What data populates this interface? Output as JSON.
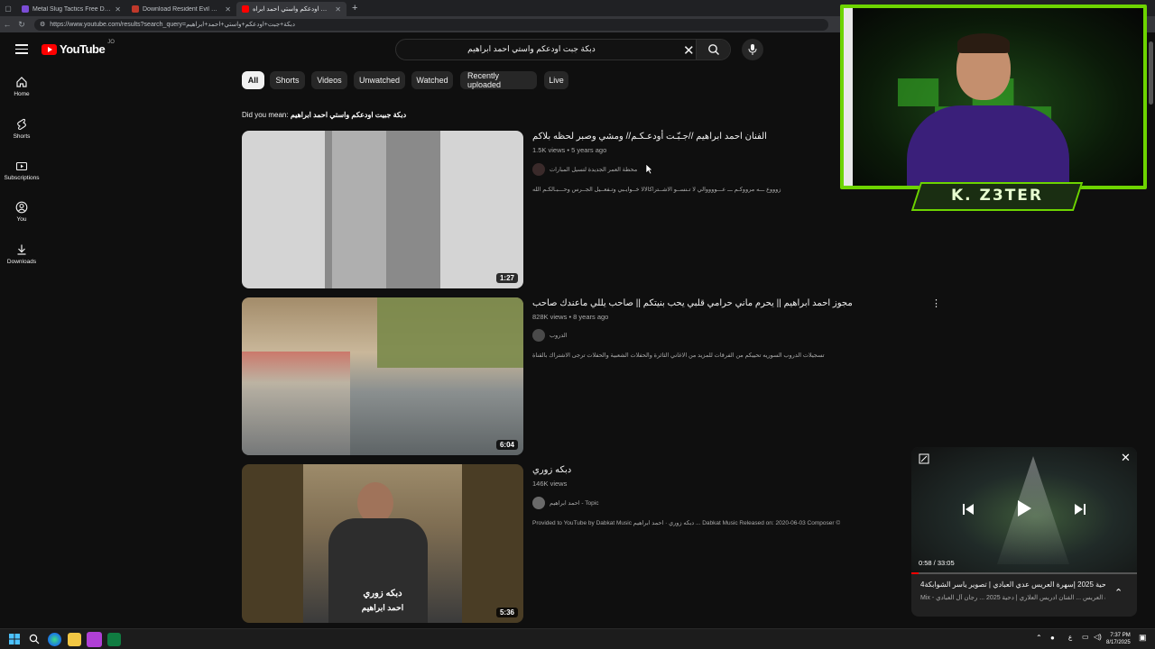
{
  "browser": {
    "tabs": [
      {
        "title": "Metal Slug Tactics Free Download",
        "color": "#7b4dd6"
      },
      {
        "title": "Download Resident Evil Village Tl",
        "color": "#c0392b"
      },
      {
        "title": "دبكة جبت اودعكم واستي احمد ابراه",
        "color": "#ff0000"
      }
    ],
    "url": "https://www.youtube.com/results?search_query=دبكة+جبت+اودعكم+واستي+احمد+ابراهيم"
  },
  "header": {
    "logo_text": "YouTube",
    "country": "JO",
    "search_value": "دبكة جبت اودعكم واستي احمد ابراهيم"
  },
  "sidebar": {
    "items": [
      {
        "label": "Home",
        "icon": "home-icon"
      },
      {
        "label": "Shorts",
        "icon": "shorts-icon"
      },
      {
        "label": "Subscriptions",
        "icon": "subscriptions-icon"
      },
      {
        "label": "You",
        "icon": "you-icon"
      },
      {
        "label": "Downloads",
        "icon": "downloads-icon"
      }
    ]
  },
  "chips": [
    "All",
    "Shorts",
    "Videos",
    "Unwatched",
    "Watched",
    "Recently uploaded",
    "Live"
  ],
  "did_you_mean": {
    "label": "Did you mean:",
    "suggestion": "دبكة جبيت اودعكم واستي احمد ابراهيم"
  },
  "results": [
    {
      "title": "الفنان احمد ابراهيم //جـبّـت أودعـكـم// ومشي وصبر لحظه بلاكم",
      "views": "1.5K views",
      "age": "5 years ago",
      "channel": "محطة العمر الجديدة لتسيل المبارات",
      "description": "زوووع ـــه مرووكـم ـــ عـــووووالي لا تـنســو الاشــتراكالالا خــوايـبي وتـفعــيل الجــرس وحـــبـالكـم الله",
      "duration": "1:27"
    },
    {
      "title": "مجوز احمد ابراهيم || يحرم ماني حرامي قلبي يحب بنيتكم || صاحب يللي ماعندك صاحب",
      "views": "828K views",
      "age": "8 years ago",
      "channel": "الدروب",
      "description": "تسجيلات الدروب السوريه تحييكم من الفرقات للمزيد من الاغاني الثائرة والحفلات الشعبية والحفلات ترجى الاشتراك بالقناة",
      "duration": "6:04"
    },
    {
      "title": "دبكه زوري",
      "views": "146K views",
      "age": "",
      "channel": "احمد ابراهيم - Topic",
      "description": "Provided to YouTube by Dabkat Music دبكه زوري · احمد ابراهيم ... Dabkat Music Released on: 2020-06-03 Composer ©",
      "duration": "5:36",
      "thumb_caption_1": "دبكه زوري",
      "thumb_caption_2": "احمد ابراهيم"
    }
  ],
  "stream_overlay": {
    "name": "K. Z3TER"
  },
  "miniplayer": {
    "time": "0:58 / 33:05",
    "progress": 0.03,
    "title": "4دحية 2025 إسهرة العريس عدي العبادي | تصوير ياسر الشوابكة|",
    "subtitle": "Mix - إسهرة العريس ... الفنان ادريس العلاري | دحية 2025 ... رجان آل العبادي"
  },
  "taskbar": {
    "time": "7:37 PM",
    "date": "8/17/2025"
  },
  "colors": {
    "background": "#0f0f0f",
    "accent_red": "#ff0000",
    "stream_green": "#6dd400"
  }
}
